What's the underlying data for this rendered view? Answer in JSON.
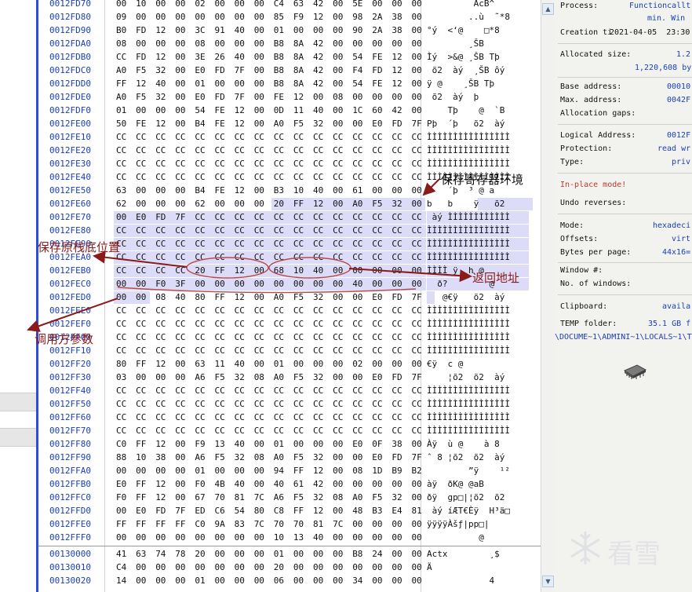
{
  "hex_view": {
    "rows": [
      {
        "addr": "0012FD70",
        "bytes": [
          "00",
          "10",
          "00",
          "00",
          "02",
          "00",
          "00",
          "00",
          "C4",
          "63",
          "42",
          "00",
          "5E",
          "00",
          "00",
          "00"
        ],
        "ascii": "         AcB^"
      },
      {
        "addr": "0012FD80",
        "bytes": [
          "09",
          "00",
          "00",
          "00",
          "00",
          "00",
          "00",
          "00",
          "85",
          "F9",
          "12",
          "00",
          "98",
          "2A",
          "38",
          "00"
        ],
        "ascii": "        ..ù  ˜*8"
      },
      {
        "addr": "0012FD90",
        "bytes": [
          "B0",
          "FD",
          "12",
          "00",
          "3C",
          "91",
          "40",
          "00",
          "01",
          "00",
          "00",
          "00",
          "90",
          "2A",
          "38",
          "00"
        ],
        "ascii": "°ý  <‘@    □*8"
      },
      {
        "addr": "0012FDA0",
        "bytes": [
          "08",
          "00",
          "00",
          "00",
          "08",
          "00",
          "00",
          "00",
          "B8",
          "8A",
          "42",
          "00",
          "00",
          "00",
          "00",
          "00"
        ],
        "ascii": "        ¸ŠB"
      },
      {
        "addr": "0012FDB0",
        "bytes": [
          "CC",
          "FD",
          "12",
          "00",
          "3E",
          "26",
          "40",
          "00",
          "B8",
          "8A",
          "42",
          "00",
          "54",
          "FE",
          "12",
          "00"
        ],
        "ascii": "Ìý  >&@ ¸ŠB Tþ"
      },
      {
        "addr": "0012FDC0",
        "bytes": [
          "A0",
          "F5",
          "32",
          "00",
          "E0",
          "FD",
          "7F",
          "00",
          "B8",
          "8A",
          "42",
          "00",
          "F4",
          "FD",
          "12",
          "00"
        ],
        "ascii": " õ2  àý  ¸ŠB ôý"
      },
      {
        "addr": "0012FDD0",
        "bytes": [
          "FF",
          "12",
          "40",
          "00",
          "01",
          "00",
          "00",
          "00",
          "B8",
          "8A",
          "42",
          "00",
          "54",
          "FE",
          "12",
          "00"
        ],
        "ascii": "ÿ @    ¸ŠB Tþ"
      },
      {
        "addr": "0012FDE0",
        "bytes": [
          "A0",
          "F5",
          "32",
          "00",
          "E0",
          "FD",
          "7F",
          "00",
          "FE",
          "12",
          "00",
          "08",
          "00",
          "00",
          "00",
          "00"
        ],
        "ascii": " õ2  àý  þ"
      },
      {
        "addr": "0012FDF0",
        "bytes": [
          "01",
          "00",
          "00",
          "00",
          "54",
          "FE",
          "12",
          "00",
          "0D",
          "11",
          "40",
          "00",
          "1C",
          "60",
          "42",
          "00"
        ],
        "ascii": "    Tþ    @  `B"
      },
      {
        "addr": "0012FE00",
        "bytes": [
          "50",
          "FE",
          "12",
          "00",
          "B4",
          "FE",
          "12",
          "00",
          "A0",
          "F5",
          "32",
          "00",
          "00",
          "E0",
          "FD",
          "7F"
        ],
        "ascii": "Pþ  ´þ   õ2  àý"
      },
      {
        "addr": "0012FE10",
        "bytes": [
          "CC",
          "CC",
          "CC",
          "CC",
          "CC",
          "CC",
          "CC",
          "CC",
          "CC",
          "CC",
          "CC",
          "CC",
          "CC",
          "CC",
          "CC",
          "CC"
        ],
        "ascii": "ÌÌÌÌÌÌÌÌÌÌÌÌÌÌÌÌ"
      },
      {
        "addr": "0012FE20",
        "bytes": [
          "CC",
          "CC",
          "CC",
          "CC",
          "CC",
          "CC",
          "CC",
          "CC",
          "CC",
          "CC",
          "CC",
          "CC",
          "CC",
          "CC",
          "CC",
          "CC"
        ],
        "ascii": "ÌÌÌÌÌÌÌÌÌÌÌÌÌÌÌÌ"
      },
      {
        "addr": "0012FE30",
        "bytes": [
          "CC",
          "CC",
          "CC",
          "CC",
          "CC",
          "CC",
          "CC",
          "CC",
          "CC",
          "CC",
          "CC",
          "CC",
          "CC",
          "CC",
          "CC",
          "CC"
        ],
        "ascii": "ÌÌÌÌÌÌÌÌÌÌÌÌÌÌÌÌ"
      },
      {
        "addr": "0012FE40",
        "bytes": [
          "CC",
          "CC",
          "CC",
          "CC",
          "CC",
          "CC",
          "CC",
          "CC",
          "CC",
          "CC",
          "CC",
          "CC",
          "CC",
          "CC",
          "CC",
          "CC"
        ],
        "ascii": "ÌÌÌÌÌÌÌÌÌÌÌÌÌÌÌÌ"
      },
      {
        "addr": "0012FE50",
        "bytes": [
          "63",
          "00",
          "00",
          "00",
          "B4",
          "FE",
          "12",
          "00",
          "B3",
          "10",
          "40",
          "00",
          "61",
          "00",
          "00",
          "00"
        ],
        "ascii": "c   ´þ  ³ @ a"
      },
      {
        "addr": "0012FE60",
        "bytes": [
          "62",
          "00",
          "00",
          "00",
          "62",
          "00",
          "00",
          "00",
          "20",
          "FF",
          "12",
          "00",
          "A0",
          "F5",
          "32",
          "00"
        ],
        "ascii": "b   b    ÿ   õ2"
      },
      {
        "addr": "0012FE70",
        "bytes": [
          "00",
          "E0",
          "FD",
          "7F",
          "CC",
          "CC",
          "CC",
          "CC",
          "CC",
          "CC",
          "CC",
          "CC",
          "CC",
          "CC",
          "CC",
          "CC"
        ],
        "ascii": " àý ÌÌÌÌÌÌÌÌÌÌÌÌ"
      },
      {
        "addr": "0012FE80",
        "bytes": [
          "CC",
          "CC",
          "CC",
          "CC",
          "CC",
          "CC",
          "CC",
          "CC",
          "CC",
          "CC",
          "CC",
          "CC",
          "CC",
          "CC",
          "CC",
          "CC"
        ],
        "ascii": "ÌÌÌÌÌÌÌÌÌÌÌÌÌÌÌÌ"
      },
      {
        "addr": "0012FE90",
        "bytes": [
          "CC",
          "CC",
          "CC",
          "CC",
          "CC",
          "CC",
          "CC",
          "CC",
          "CC",
          "CC",
          "CC",
          "CC",
          "CC",
          "CC",
          "CC",
          "CC"
        ],
        "ascii": "ÌÌÌÌÌÌÌÌÌÌÌÌÌÌÌÌ"
      },
      {
        "addr": "0012FEA0",
        "bytes": [
          "CC",
          "CC",
          "CC",
          "CC",
          "CC",
          "CC",
          "CC",
          "CC",
          "CC",
          "CC",
          "CC",
          "CC",
          "CC",
          "CC",
          "CC",
          "CC"
        ],
        "ascii": "ÌÌÌÌÌÌÌÌÌÌÌÌÌÌÌÌ"
      },
      {
        "addr": "0012FEB0",
        "bytes": [
          "CC",
          "CC",
          "CC",
          "CC",
          "20",
          "FF",
          "12",
          "00",
          "68",
          "10",
          "40",
          "00",
          "00",
          "00",
          "00",
          "00"
        ],
        "ascii": "ÌÌÌÌ ÿ  h @"
      },
      {
        "addr": "0012FEC0",
        "bytes": [
          "00",
          "00",
          "F0",
          "3F",
          "00",
          "00",
          "00",
          "00",
          "00",
          "00",
          "00",
          "00",
          "40",
          "00",
          "00",
          "00"
        ],
        "ascii": "  ð?        @"
      },
      {
        "addr": "0012FED0",
        "bytes": [
          "00",
          "00",
          "08",
          "40",
          "80",
          "FF",
          "12",
          "00",
          "A0",
          "F5",
          "32",
          "00",
          "00",
          "E0",
          "FD",
          "7F"
        ],
        "ascii": "   @€ÿ   õ2  àý"
      },
      {
        "addr": "0012FEE0",
        "bytes": [
          "CC",
          "CC",
          "CC",
          "CC",
          "CC",
          "CC",
          "CC",
          "CC",
          "CC",
          "CC",
          "CC",
          "CC",
          "CC",
          "CC",
          "CC",
          "CC"
        ],
        "ascii": "ÌÌÌÌÌÌÌÌÌÌÌÌÌÌÌÌ"
      },
      {
        "addr": "0012FEF0",
        "bytes": [
          "CC",
          "CC",
          "CC",
          "CC",
          "CC",
          "CC",
          "CC",
          "CC",
          "CC",
          "CC",
          "CC",
          "CC",
          "CC",
          "CC",
          "CC",
          "CC"
        ],
        "ascii": "ÌÌÌÌÌÌÌÌÌÌÌÌÌÌÌÌ"
      },
      {
        "addr": "0012FF00",
        "bytes": [
          "CC",
          "CC",
          "CC",
          "CC",
          "CC",
          "CC",
          "CC",
          "CC",
          "CC",
          "CC",
          "CC",
          "CC",
          "CC",
          "CC",
          "CC",
          "CC"
        ],
        "ascii": "ÌÌÌÌÌÌÌÌÌÌÌÌÌÌÌÌ"
      },
      {
        "addr": "0012FF10",
        "bytes": [
          "CC",
          "CC",
          "CC",
          "CC",
          "CC",
          "CC",
          "CC",
          "CC",
          "CC",
          "CC",
          "CC",
          "CC",
          "CC",
          "CC",
          "CC",
          "CC"
        ],
        "ascii": "ÌÌÌÌÌÌÌÌÌÌÌÌÌÌÌÌ"
      },
      {
        "addr": "0012FF20",
        "bytes": [
          "80",
          "FF",
          "12",
          "00",
          "63",
          "11",
          "40",
          "00",
          "01",
          "00",
          "00",
          "00",
          "02",
          "00",
          "00",
          "00"
        ],
        "ascii": "€ÿ  c @"
      },
      {
        "addr": "0012FF30",
        "bytes": [
          "03",
          "00",
          "00",
          "00",
          "A6",
          "F5",
          "32",
          "08",
          "A0",
          "F5",
          "32",
          "00",
          "00",
          "E0",
          "FD",
          "7F"
        ],
        "ascii": "    ¦õ2  õ2  àý"
      },
      {
        "addr": "0012FF40",
        "bytes": [
          "CC",
          "CC",
          "CC",
          "CC",
          "CC",
          "CC",
          "CC",
          "CC",
          "CC",
          "CC",
          "CC",
          "CC",
          "CC",
          "CC",
          "CC",
          "CC"
        ],
        "ascii": "ÌÌÌÌÌÌÌÌÌÌÌÌÌÌÌÌ"
      },
      {
        "addr": "0012FF50",
        "bytes": [
          "CC",
          "CC",
          "CC",
          "CC",
          "CC",
          "CC",
          "CC",
          "CC",
          "CC",
          "CC",
          "CC",
          "CC",
          "CC",
          "CC",
          "CC",
          "CC"
        ],
        "ascii": "ÌÌÌÌÌÌÌÌÌÌÌÌÌÌÌÌ"
      },
      {
        "addr": "0012FF60",
        "bytes": [
          "CC",
          "CC",
          "CC",
          "CC",
          "CC",
          "CC",
          "CC",
          "CC",
          "CC",
          "CC",
          "CC",
          "CC",
          "CC",
          "CC",
          "CC",
          "CC"
        ],
        "ascii": "ÌÌÌÌÌÌÌÌÌÌÌÌÌÌÌÌ"
      },
      {
        "addr": "0012FF70",
        "bytes": [
          "CC",
          "CC",
          "CC",
          "CC",
          "CC",
          "CC",
          "CC",
          "CC",
          "CC",
          "CC",
          "CC",
          "CC",
          "CC",
          "CC",
          "CC",
          "CC"
        ],
        "ascii": "ÌÌÌÌÌÌÌÌÌÌÌÌÌÌÌÌ"
      },
      {
        "addr": "0012FF80",
        "bytes": [
          "C0",
          "FF",
          "12",
          "00",
          "F9",
          "13",
          "40",
          "00",
          "01",
          "00",
          "00",
          "00",
          "E0",
          "0F",
          "38",
          "00"
        ],
        "ascii": "Àÿ  ù @    à 8"
      },
      {
        "addr": "0012FF90",
        "bytes": [
          "88",
          "10",
          "38",
          "00",
          "A6",
          "F5",
          "32",
          "08",
          "A0",
          "F5",
          "32",
          "00",
          "00",
          "E0",
          "FD",
          "7F"
        ],
        "ascii": "ˆ 8 ¦õ2  õ2  àý"
      },
      {
        "addr": "0012FFA0",
        "bytes": [
          "00",
          "00",
          "00",
          "00",
          "01",
          "00",
          "00",
          "00",
          "94",
          "FF",
          "12",
          "00",
          "08",
          "1D",
          "B9",
          "B2"
        ],
        "ascii": "        ”ÿ    ¹²"
      },
      {
        "addr": "0012FFB0",
        "bytes": [
          "E0",
          "FF",
          "12",
          "00",
          "F0",
          "4B",
          "40",
          "00",
          "40",
          "61",
          "42",
          "00",
          "00",
          "00",
          "00",
          "00"
        ],
        "ascii": "àÿ  ðK@ @aB"
      },
      {
        "addr": "0012FFC0",
        "bytes": [
          "F0",
          "FF",
          "12",
          "00",
          "67",
          "70",
          "81",
          "7C",
          "A6",
          "F5",
          "32",
          "08",
          "A0",
          "F5",
          "32",
          "00"
        ],
        "ascii": "ðÿ  gp□|¦õ2  õ2"
      },
      {
        "addr": "0012FFD0",
        "bytes": [
          "00",
          "E0",
          "FD",
          "7F",
          "ED",
          "C6",
          "54",
          "80",
          "C8",
          "FF",
          "12",
          "00",
          "48",
          "B3",
          "E4",
          "81"
        ],
        "ascii": " àý íÆT€Èÿ  H³ä□"
      },
      {
        "addr": "0012FFE0",
        "bytes": [
          "FF",
          "FF",
          "FF",
          "FF",
          "C0",
          "9A",
          "83",
          "7C",
          "70",
          "70",
          "81",
          "7C",
          "00",
          "00",
          "00",
          "00"
        ],
        "ascii": "ÿÿÿÿÀšƒ|pp□|"
      },
      {
        "addr": "0012FFF0",
        "bytes": [
          "00",
          "00",
          "00",
          "00",
          "00",
          "00",
          "00",
          "00",
          "10",
          "13",
          "40",
          "00",
          "00",
          "00",
          "00",
          "00"
        ],
        "ascii": "          @"
      },
      {
        "addr": "00130000",
        "bytes": [
          "41",
          "63",
          "74",
          "78",
          "20",
          "00",
          "00",
          "00",
          "01",
          "00",
          "00",
          "00",
          "B8",
          "24",
          "00",
          "00"
        ],
        "ascii": "Actx        ¸$"
      },
      {
        "addr": "00130010",
        "bytes": [
          "C4",
          "00",
          "00",
          "00",
          "00",
          "00",
          "00",
          "00",
          "20",
          "00",
          "00",
          "00",
          "00",
          "00",
          "00",
          "00"
        ],
        "ascii": "Ä"
      },
      {
        "addr": "00130020",
        "bytes": [
          "14",
          "00",
          "00",
          "00",
          "01",
          "00",
          "00",
          "00",
          "06",
          "00",
          "00",
          "00",
          "34",
          "00",
          "00",
          "00"
        ],
        "ascii": "            4"
      }
    ]
  },
  "annotations": {
    "save_env": "保存寄存器环境",
    "save_stack_bottom": "保存原栈底位置",
    "return_address": "返回地址",
    "caller_args": "调用方参数",
    "color": "#8b1a1a"
  },
  "info_panel": {
    "process_label": "Process:",
    "process_value": "Functioncallt",
    "process_value2": "min. Win",
    "creation_label": "Creation ti",
    "creation_value": "2021-04-05  23:30",
    "allocated_label": "Allocated size:",
    "allocated_value": "1.2",
    "allocated_bytes": "1,220,608 by",
    "base_label": "Base address:",
    "base_value": "00010",
    "max_label": "Max. address:",
    "max_value": "0042F",
    "gaps_label": "Allocation gaps:",
    "logical_label": "Logical Address:",
    "logical_value": "0012F",
    "protection_label": "Protection:",
    "protection_value": "read wr",
    "type_label": "Type:",
    "type_value": "priv",
    "inplace": "In-place mode!",
    "undo_label": "Undo reverses:",
    "mode_label": "Mode:",
    "mode_value": "hexadeci",
    "offsets_label": "Offsets:",
    "offsets_value": "virt",
    "bpp_label": "Bytes per page:",
    "bpp_value": "44x16=",
    "window_label": "Window #:",
    "nwin_label": "No. of windows:",
    "clipboard_label": "Clipboard:",
    "clipboard_value": "availa",
    "temp_label": "TEMP folder:",
    "temp_value": "35.1 GB f",
    "temp_path": "\\DOCUME~1\\ADMINI~1\\LOCALS~1\\T",
    "accent": "#c0392b"
  },
  "watermark": {
    "text": "看雪"
  }
}
